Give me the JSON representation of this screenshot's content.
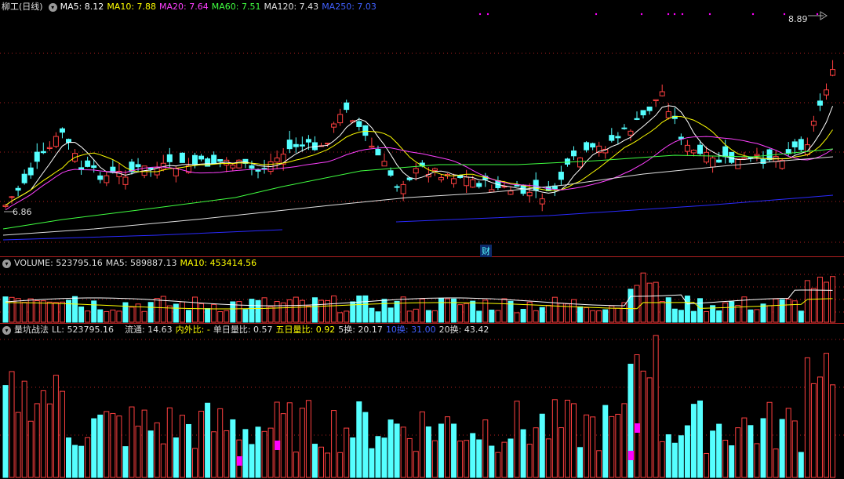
{
  "header": {
    "title": "柳工(日线)",
    "ma": [
      {
        "label": "MA5: 8.12",
        "color": "#ffffff"
      },
      {
        "label": "MA10: 7.88",
        "color": "#ffff00"
      },
      {
        "label": "MA20: 7.64",
        "color": "#ff40ff"
      },
      {
        "label": "MA60: 7.51",
        "color": "#40ff40"
      },
      {
        "label": "MA120: 7.43",
        "color": "#e0e0e0"
      },
      {
        "label": "MA250: 7.03",
        "color": "#4040ff"
      }
    ]
  },
  "price": {
    "high_label": "8.89",
    "low_label": "6.86",
    "fin_marker": "财"
  },
  "volume": {
    "title": "VOLUME: 523795.16",
    "ma5": "MA5: 589887.13",
    "ma10": "MA10: 453414.56"
  },
  "indicator": {
    "title": "量坑战法",
    "items": [
      {
        "label": "LL: 523795.16",
        "color": "#dddddd"
      },
      {
        "label": "流通: 14.63",
        "color": "#dddddd"
      },
      {
        "label": "内外比: -",
        "color": "#ffff00"
      },
      {
        "label": "单日量比: 0.57",
        "color": "#dddddd"
      },
      {
        "label": "五日量比: 0.92",
        "color": "#ffff00"
      },
      {
        "label": "5换: 20.17",
        "color": "#dddddd"
      },
      {
        "label": "10换: 31.00",
        "color": "#4060ff"
      },
      {
        "label": "20换: 43.42",
        "color": "#dddddd"
      }
    ]
  },
  "colors": {
    "up": "#ff4040",
    "down": "#55ffff",
    "grid": "#b02020",
    "accent": "#ff00ff"
  }
}
